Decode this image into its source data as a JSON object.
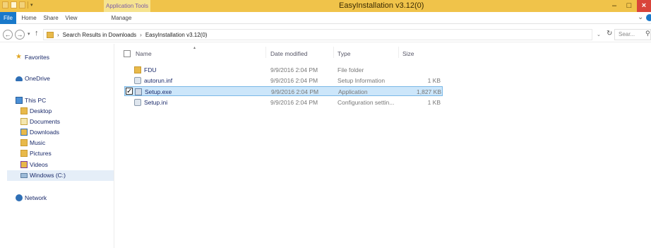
{
  "titlebar": {
    "context_tab": "Application Tools",
    "title": "EasyInstallation v3.12(0)",
    "minimize": "–",
    "maximize": "□",
    "close": "×"
  },
  "ribbon": {
    "tabs": [
      "File",
      "Home",
      "Share",
      "View",
      "Manage"
    ]
  },
  "address": {
    "crumbs": [
      "Search Results in Downloads",
      "EasyInstallation v3.12(0)"
    ],
    "search_placeholder": "Sear..."
  },
  "nav": {
    "favorites": "Favorites",
    "onedrive": "OneDrive",
    "this_pc": "This PC",
    "items": [
      "Desktop",
      "Documents",
      "Downloads",
      "Music",
      "Pictures",
      "Videos",
      "Windows (C:)"
    ],
    "network": "Network"
  },
  "columns": {
    "name": "Name",
    "date": "Date modified",
    "type": "Type",
    "size": "Size"
  },
  "files": [
    {
      "name": "FDU",
      "date": "9/9/2016 2:04 PM",
      "type": "File folder",
      "size": "",
      "icon": "folder-icon"
    },
    {
      "name": "autorun.inf",
      "date": "9/9/2016 2:04 PM",
      "type": "Setup Information",
      "size": "1 KB",
      "icon": "settings-file-icon"
    },
    {
      "name": "Setup.exe",
      "date": "9/9/2016 2:04 PM",
      "type": "Application",
      "size": "1,827 KB",
      "icon": "application-icon"
    },
    {
      "name": "Setup.ini",
      "date": "9/9/2016 2:04 PM",
      "type": "Configuration settin...",
      "size": "1 KB",
      "icon": "settings-file-icon"
    }
  ],
  "selected_file_index": 2,
  "colors": {
    "titlebar": "#f0c34a",
    "file_tab": "#1979ca",
    "selection": "#cce6fa",
    "close_button": "#d9443a"
  }
}
